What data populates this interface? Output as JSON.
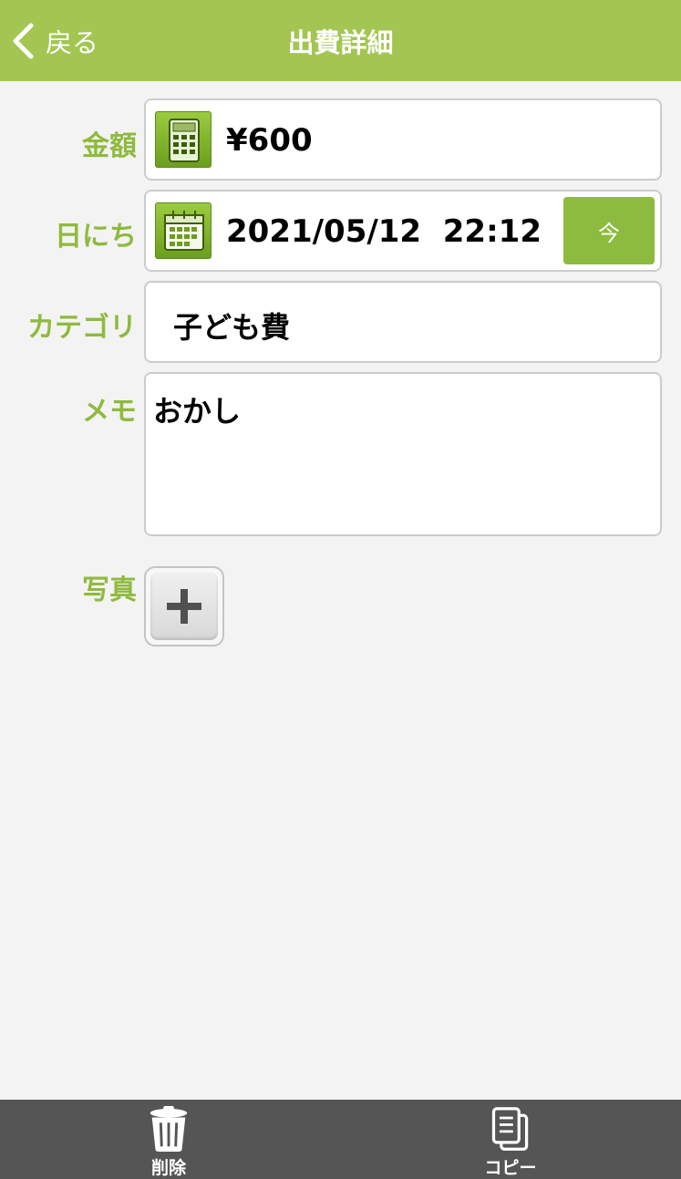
{
  "header": {
    "back_label": "戻る",
    "title": "出費詳細"
  },
  "amount": {
    "label": "金額",
    "value": "¥600",
    "icon": "calculator-icon"
  },
  "date": {
    "label": "日にち",
    "value": "2021/05/12  22:12",
    "now_label": "今",
    "icon": "calendar-icon"
  },
  "category": {
    "label": "カテゴリ",
    "value": "子ども費"
  },
  "memo": {
    "label": "メモ",
    "value": "おかし"
  },
  "photo": {
    "label": "写真",
    "icon": "plus-icon"
  },
  "footer": {
    "delete_label": "削除",
    "copy_label": "コピー"
  },
  "colors": {
    "accent": "#a2c651",
    "label": "#8fba3e",
    "footer": "#555555"
  }
}
